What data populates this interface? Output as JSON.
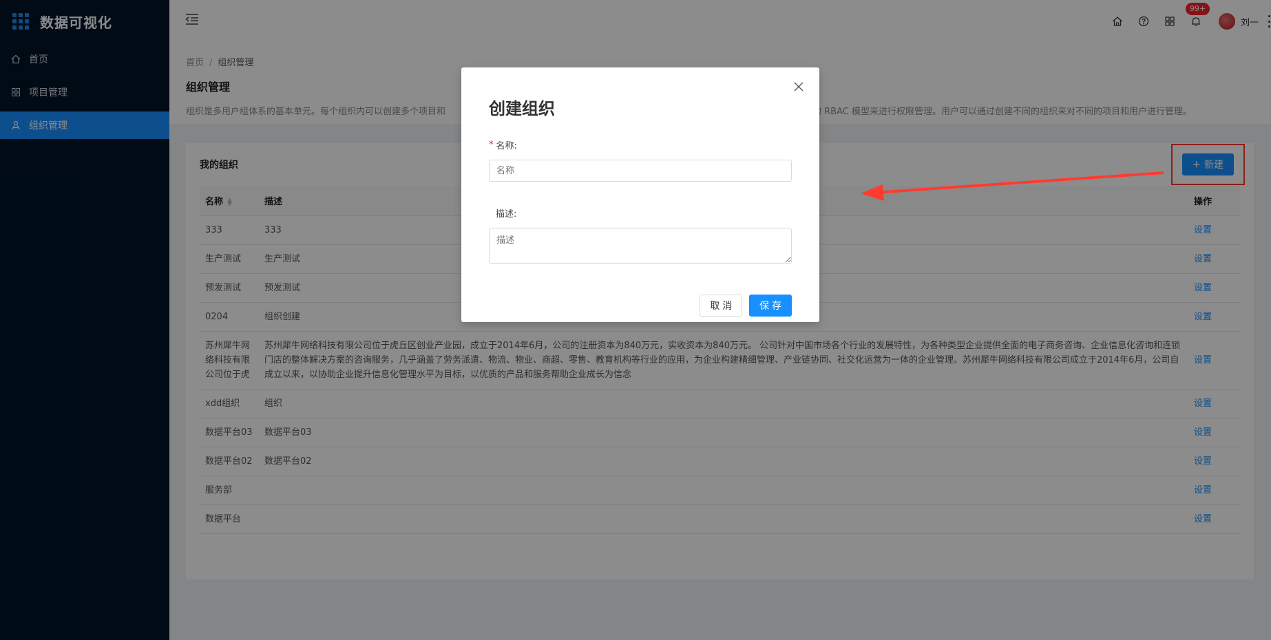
{
  "app": {
    "title": "数据可视化"
  },
  "sidebar": {
    "items": [
      {
        "label": "首页",
        "icon": "home-icon"
      },
      {
        "label": "项目管理",
        "icon": "grid-icon"
      },
      {
        "label": "组织管理",
        "icon": "org-icon",
        "active": true
      }
    ]
  },
  "header": {
    "badge": "99+",
    "user_name": "刘一"
  },
  "breadcrumb": {
    "home": "首页",
    "separator": "/",
    "current": "组织管理"
  },
  "page": {
    "title": "组织管理",
    "description_left": "组织是多用户组体系的基本单元。每个组织内可以创建多个项目和",
    "description_right": "本的 RBAC 模型来进行权限管理。用户可以通过创建不同的组织来对不同的项目和用户进行管理。"
  },
  "card": {
    "title": "我的组织",
    "new_label": "新建"
  },
  "table": {
    "headers": {
      "name": "名称",
      "desc": "描述",
      "op": "操作"
    },
    "rows": [
      {
        "name": "333",
        "desc": "333",
        "op": "设置"
      },
      {
        "name": "生产测试",
        "desc": "生产测试",
        "op": "设置"
      },
      {
        "name": "预发测试",
        "desc": "预发测试",
        "op": "设置"
      },
      {
        "name": "0204",
        "desc": "组织创建",
        "op": "设置"
      },
      {
        "name": "苏州犀牛网络科技有限公司位于虎",
        "desc": "苏州犀牛网络科技有限公司位于虎丘区创业产业园，成立于2014年6月，公司的注册资本为840万元，实收资本为840万元。 公司针对中国市场各个行业的发展特性，为各种类型企业提供全面的电子商务咨询、企业信息化咨询和连锁门店的整体解决方案的咨询服务，几乎涵盖了劳务派遣、物流、物业、商超、零售、教育机构等行业的应用，为企业构建精细管理、产业链协同、社交化运营为一体的企业管理。苏州犀牛网络科技有限公司成立于2014年6月，公司自成立以来，以协助企业提升信息化管理水平为目标，以优质的产品和服务帮助企业成长为信念",
        "op": "设置"
      },
      {
        "name": "xdd组织",
        "desc": "组织",
        "op": "设置"
      },
      {
        "name": "数据平台03",
        "desc": "数据平台03",
        "op": "设置"
      },
      {
        "name": "数据平台02",
        "desc": "数据平台02",
        "op": "设置"
      },
      {
        "name": "服务部",
        "desc": "",
        "op": "设置"
      },
      {
        "name": "数据平台",
        "desc": "",
        "op": "设置"
      }
    ]
  },
  "modal": {
    "title": "创建组织",
    "name_label": "名称:",
    "name_placeholder": "名称",
    "desc_label": "描述:",
    "desc_placeholder": "描述",
    "cancel": "取 消",
    "save": "保 存"
  },
  "colors": {
    "primary": "#1890ff",
    "sidebar_bg": "#001529",
    "annotation_red": "#ff3b30"
  }
}
